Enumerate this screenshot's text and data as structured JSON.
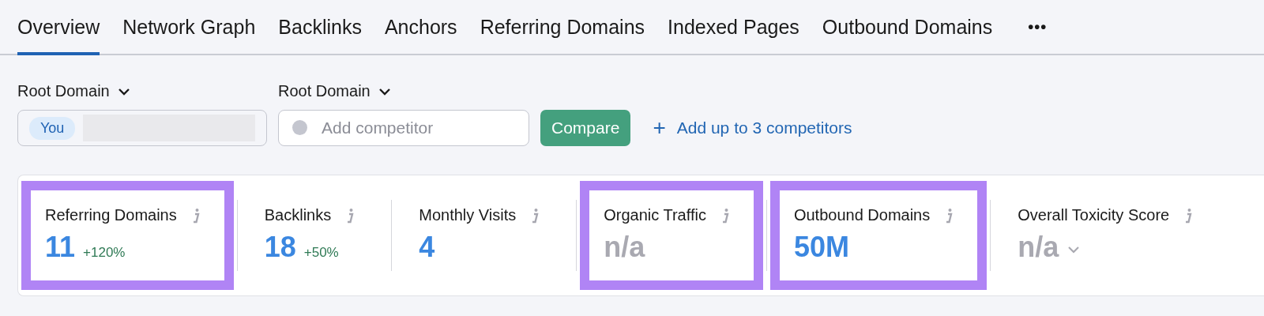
{
  "tabs": [
    {
      "label": "Overview",
      "selected": true
    },
    {
      "label": "Network Graph",
      "selected": false
    },
    {
      "label": "Backlinks",
      "selected": false
    },
    {
      "label": "Anchors",
      "selected": false
    },
    {
      "label": "Referring Domains",
      "selected": false
    },
    {
      "label": "Indexed Pages",
      "selected": false
    },
    {
      "label": "Outbound Domains",
      "selected": false
    }
  ],
  "more_button": "•••",
  "domain_selectors": [
    {
      "label": "Root Domain"
    },
    {
      "label": "Root Domain"
    }
  ],
  "you_field": {
    "badge": "You"
  },
  "competitor_field": {
    "placeholder": "Add competitor"
  },
  "compare_button": "Compare",
  "add_link": {
    "icon": "+",
    "label": "Add up to 3 competitors"
  },
  "metrics": [
    {
      "label": "Referring Domains",
      "value": "11",
      "change": "+120%",
      "muted": false,
      "highlighted": true,
      "dropdown": false
    },
    {
      "label": "Backlinks",
      "value": "18",
      "change": "+50%",
      "muted": false,
      "highlighted": false,
      "dropdown": false
    },
    {
      "label": "Monthly Visits",
      "value": "4",
      "muted": false,
      "highlighted": false,
      "dropdown": false
    },
    {
      "label": "Organic Traffic",
      "value": "n/a",
      "muted": true,
      "highlighted": true,
      "dropdown": false
    },
    {
      "label": "Outbound Domains",
      "value": "50M",
      "muted": false,
      "highlighted": true,
      "dropdown": false
    },
    {
      "label": "Overall Toxicity Score",
      "value": "n/a",
      "muted": true,
      "highlighted": false,
      "dropdown": true
    }
  ]
}
